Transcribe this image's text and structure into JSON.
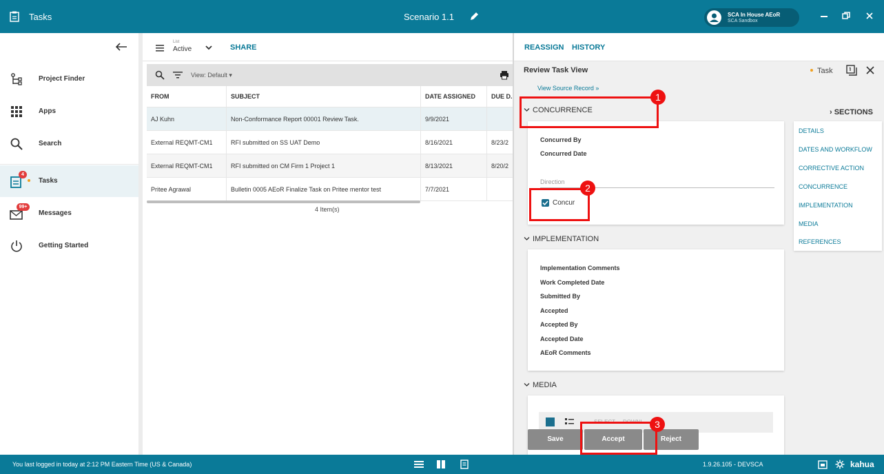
{
  "titlebar": {
    "app_title": "Tasks",
    "scenario": "Scenario 1.1",
    "user_name": "SCA In House AEoR",
    "user_sub": "SCA Sandbox"
  },
  "sidebar": {
    "items": [
      {
        "label": "Project Finder",
        "icon": "project-finder-icon"
      },
      {
        "label": "Apps",
        "icon": "apps-grid-icon"
      },
      {
        "label": "Search",
        "icon": "search-icon"
      },
      {
        "label": "Tasks",
        "icon": "tasks-icon",
        "badge": "4"
      },
      {
        "label": "Messages",
        "icon": "messages-icon",
        "badge": "99+"
      },
      {
        "label": "Getting Started",
        "icon": "power-icon"
      }
    ]
  },
  "list": {
    "list_label": "List",
    "list_value": "Active",
    "share": "SHARE",
    "view": "View: Default ▾",
    "columns": [
      "FROM",
      "SUBJECT",
      "DATE ASSIGNED",
      "DUE D..."
    ],
    "rows": [
      {
        "from": "AJ Kuhn",
        "subject": "Non-Conformance Report 00001 Review Task.",
        "date": "9/9/2021",
        "due": ""
      },
      {
        "from": "External REQMT-CM1",
        "subject": "RFI  submitted on SS UAT Demo",
        "date": "8/16/2021",
        "due": "8/23/2"
      },
      {
        "from": "External REQMT-CM1",
        "subject": "RFI  submitted on CM Firm 1 Project 1",
        "date": "8/13/2021",
        "due": "8/20/2"
      },
      {
        "from": "Pritee Agrawal",
        "subject": "Bulletin 0005 AEoR Finalize Task on Pritee mentor test",
        "date": "7/7/2021",
        "due": ""
      }
    ],
    "item_count": "4 Item(s)"
  },
  "review": {
    "reassign": "REASSIGN",
    "history": "HISTORY",
    "title": "Review Task View",
    "view_source": "View Source Record »",
    "task_label": "Task",
    "concurrence_header": "CONCURRENCE",
    "concurred_by": "Concurred By",
    "concurred_date": "Concurred Date",
    "direction_label": "Direction",
    "concur_label": "Concur",
    "concur_checked": true,
    "implementation_header": "IMPLEMENTATION",
    "implementation_fields": [
      "Implementation Comments",
      "Work Completed Date",
      "Submitted By",
      "Accepted",
      "Accepted By",
      "Accepted Date",
      "AEoR Comments"
    ],
    "media_header": "MEDIA",
    "media_select": "SELECT",
    "media_download": "DOWNL",
    "sections_header": "› SECTIONS",
    "sections": [
      "DETAILS",
      "DATES AND WORKFLOW",
      "CORRECTIVE ACTION",
      "CONCURRENCE",
      "IMPLEMENTATION",
      "MEDIA",
      "REFERENCES"
    ],
    "buttons": {
      "save": "Save",
      "accept": "Accept",
      "reject": "Reject"
    }
  },
  "annotations": [
    "1",
    "2",
    "3"
  ],
  "footer": {
    "login": "You last logged in today at 2:12 PM Eastern Time (US & Canada)",
    "version": "1.9.26.105 - DEVSCA",
    "brand": "kahua"
  },
  "colors": {
    "brand": "#0a7a98",
    "annotation": "#ee1111",
    "badge": "#e23c3c"
  }
}
